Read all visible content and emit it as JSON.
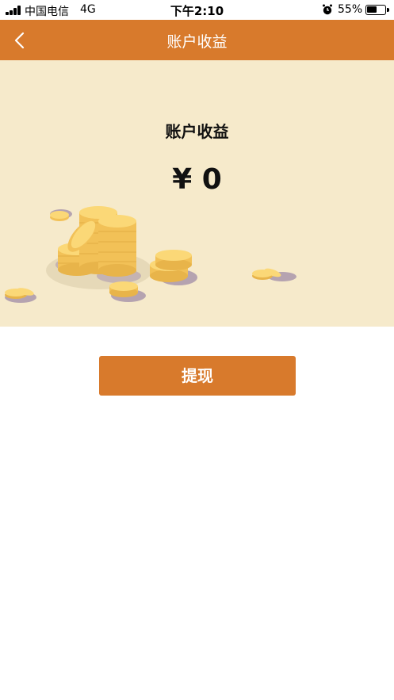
{
  "status_bar": {
    "carrier": "中国电信",
    "network": "4G",
    "time": "下午2:10",
    "battery_percent": "55%",
    "battery_level": 0.55,
    "alarm_icon": "alarm-icon"
  },
  "nav": {
    "title": "账户收益",
    "back_icon": "chevron-left-icon",
    "color": "#d87a2c"
  },
  "hero": {
    "title": "账户收益",
    "amount": "¥ 0",
    "background": "#f6eacb",
    "illustration_icon": "coins-icon"
  },
  "actions": {
    "withdraw_label": "提现"
  }
}
